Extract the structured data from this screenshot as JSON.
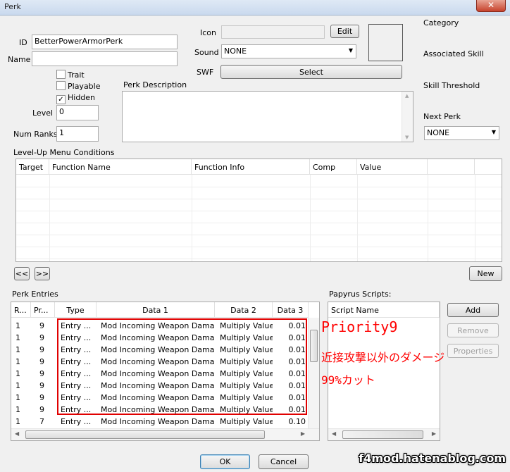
{
  "window": {
    "title": "Perk",
    "close_glyph": "✕"
  },
  "fields": {
    "id_label": "ID",
    "id_value": "BetterPowerArmorPerk",
    "name_label": "Name",
    "name_value": "",
    "trait_label": "Trait",
    "playable_label": "Playable",
    "hidden_label": "Hidden",
    "level_label": "Level",
    "level_value": "0",
    "num_ranks_label": "Num Ranks",
    "num_ranks_value": "1",
    "icon_label": "Icon",
    "icon_value": "",
    "edit_label": "Edit",
    "sound_label": "Sound",
    "sound_value": "NONE",
    "swf_label": "SWF",
    "select_label": "Select",
    "desc_label": "Perk Description",
    "desc_value": "",
    "category_label": "Category",
    "assoc_skill_label": "Associated Skill",
    "skill_threshold_label": "Skill Threshold",
    "next_perk_label": "Next Perk",
    "next_perk_value": "NONE"
  },
  "checkboxes": {
    "trait": false,
    "playable": false,
    "hidden": true
  },
  "conditions": {
    "label": "Level-Up Menu Conditions",
    "columns": [
      "Target",
      "Function Name",
      "Function Info",
      "Comp",
      "Value"
    ],
    "prev_label": "<<",
    "next_label": ">>",
    "new_label": "New"
  },
  "perk_entries": {
    "label": "Perk Entries",
    "columns": [
      "R...",
      "Pr...",
      "Type",
      "Data 1",
      "Data 2",
      "Data 3"
    ],
    "rows": [
      [
        "1",
        "9",
        "Entry ...",
        "Mod Incoming Weapon Damage",
        "Multiply Value",
        "0.01"
      ],
      [
        "1",
        "9",
        "Entry ...",
        "Mod Incoming Weapon Damage",
        "Multiply Value",
        "0.01"
      ],
      [
        "1",
        "9",
        "Entry ...",
        "Mod Incoming Weapon Damage",
        "Multiply Value",
        "0.01"
      ],
      [
        "1",
        "9",
        "Entry ...",
        "Mod Incoming Weapon Damage",
        "Multiply Value",
        "0.01"
      ],
      [
        "1",
        "9",
        "Entry ...",
        "Mod Incoming Weapon Damage",
        "Multiply Value",
        "0.01"
      ],
      [
        "1",
        "9",
        "Entry ...",
        "Mod Incoming Weapon Damage",
        "Multiply Value",
        "0.01"
      ],
      [
        "1",
        "9",
        "Entry ...",
        "Mod Incoming Weapon Damage",
        "Multiply Value",
        "0.01"
      ],
      [
        "1",
        "9",
        "Entry ...",
        "Mod Incoming Weapon Damage",
        "Multiply Value",
        "0.01"
      ],
      [
        "1",
        "7",
        "Entry ...",
        "Mod Incoming Weapon Damage",
        "Multiply Value",
        "0.10"
      ]
    ]
  },
  "papyrus": {
    "label": "Papyrus Scripts:",
    "column": "Script Name",
    "add_label": "Add",
    "remove_label": "Remove",
    "properties_label": "Properties"
  },
  "annotations": {
    "line1": "Priority9",
    "line2": "近接攻撃以外のダメージ",
    "line3": "99%カット",
    "color": "#ff0000"
  },
  "footer": {
    "ok_label": "OK",
    "cancel_label": "Cancel"
  },
  "watermark": "f4mod.hatenablog.com"
}
